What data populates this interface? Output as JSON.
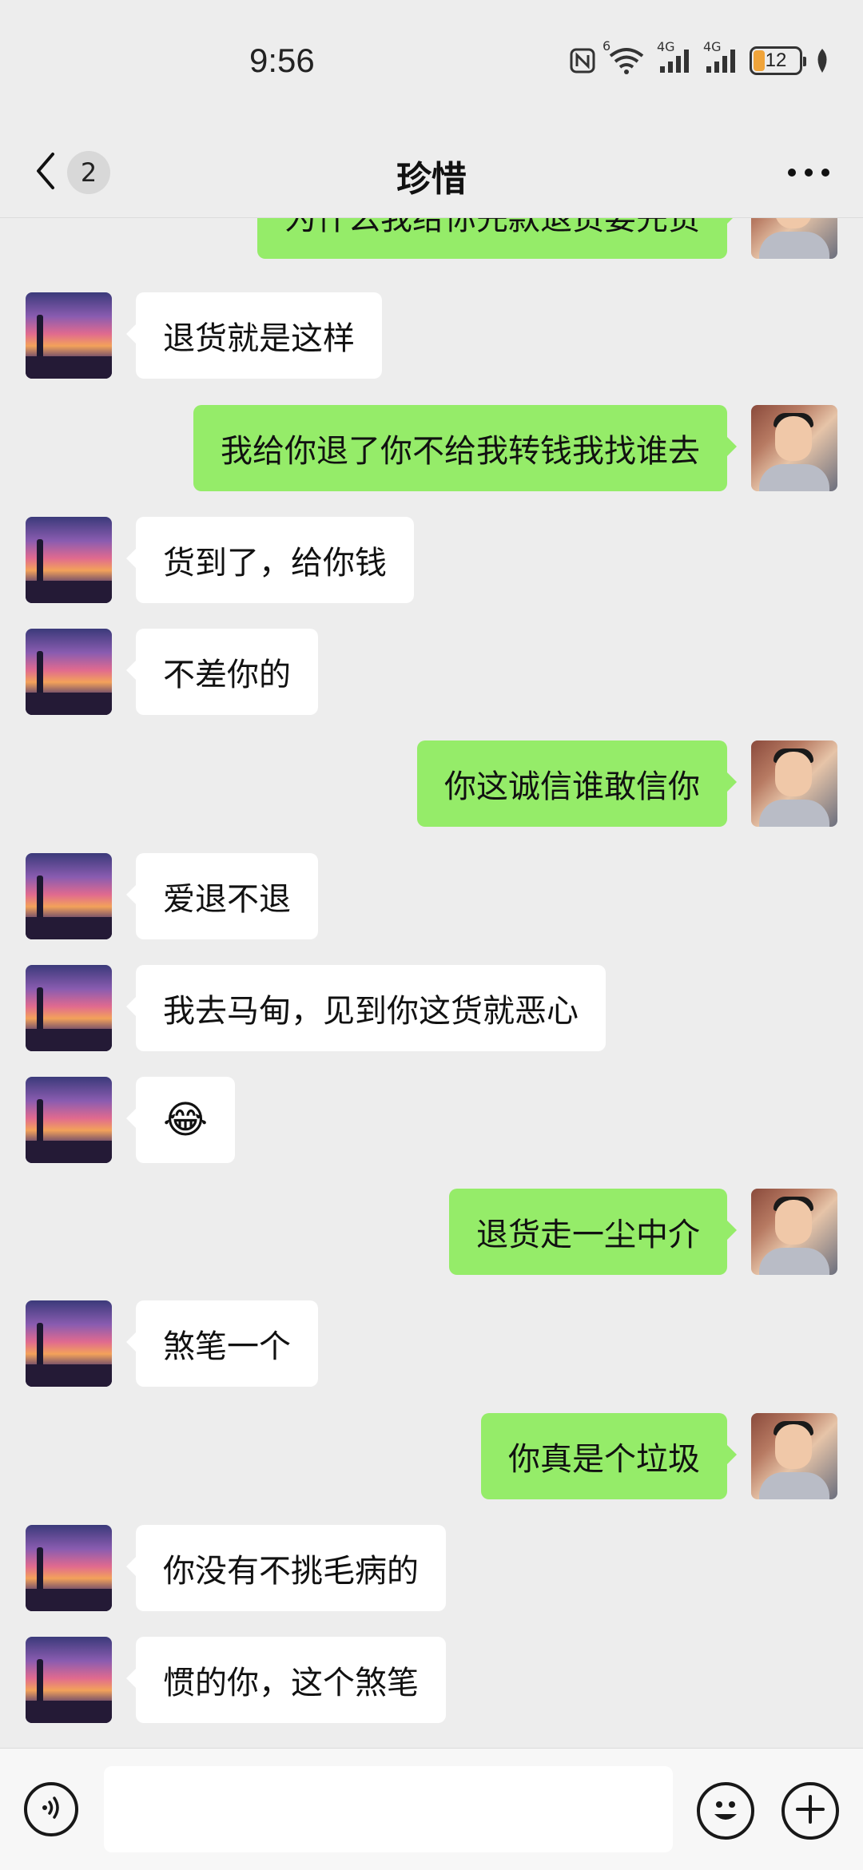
{
  "status_bar": {
    "time": "9:56",
    "network_1": "4G",
    "network_2": "4G",
    "wifi_label": "6",
    "battery_level": "12",
    "battery_color": "#f0a43a",
    "icons": [
      "nfc-icon",
      "wifi-icon",
      "signal-icon",
      "signal-icon",
      "battery-icon",
      "leaf-icon"
    ]
  },
  "header": {
    "unread_count": "2",
    "title": "珍惜",
    "back_icon": "chevron-left-icon",
    "more_icon": "more-dots-icon"
  },
  "colors": {
    "background": "#ededed",
    "self_bubble": "#95ec69",
    "other_bubble": "#ffffff"
  },
  "messages": [
    {
      "from": "self",
      "text": "为什么我给你先款退货要先货"
    },
    {
      "from": "contact",
      "text": "退货就是这样"
    },
    {
      "from": "self",
      "text": "我给你退了你不给我转钱我找谁去"
    },
    {
      "from": "contact",
      "text": "货到了，给你钱"
    },
    {
      "from": "contact",
      "text": "不差你的"
    },
    {
      "from": "self",
      "text": "你这诚信谁敢信你"
    },
    {
      "from": "contact",
      "text": "爱退不退"
    },
    {
      "from": "contact",
      "text": "我去马甸，见到你这货就恶心"
    },
    {
      "from": "contact",
      "text": "😂"
    },
    {
      "from": "self",
      "text": "退货走一尘中介"
    },
    {
      "from": "contact",
      "text": "煞笔一个"
    },
    {
      "from": "self",
      "text": "你真是个垃圾"
    },
    {
      "from": "contact",
      "text": "你没有不挑毛病的"
    },
    {
      "from": "contact",
      "text": "惯的你，这个煞笔"
    }
  ],
  "input_bar": {
    "text_value": "",
    "voice_icon": "voice-icon",
    "emoji_icon": "emoji-icon",
    "plus_icon": "plus-icon"
  }
}
